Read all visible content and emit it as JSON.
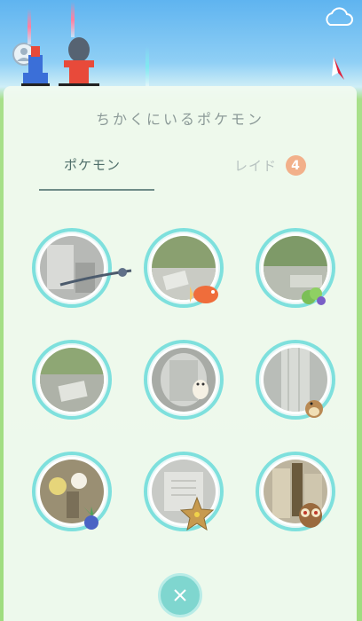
{
  "panel": {
    "title": "ちかくにいるポケモン"
  },
  "tabs": {
    "pokemon_label": "ポケモン",
    "raid_label": "レイド",
    "raid_count": "4"
  },
  "nearby_pokemon": [
    {
      "name": "",
      "icon": "weavile-icon"
    },
    {
      "name": "",
      "icon": "magikarp-icon"
    },
    {
      "name": "",
      "icon": "caterpie-icon"
    },
    {
      "name": "",
      "icon": "empty-slot"
    },
    {
      "name": "",
      "icon": "togepi-icon"
    },
    {
      "name": "",
      "icon": "pidgey-icon"
    },
    {
      "name": "",
      "icon": "oddish-icon"
    },
    {
      "name": "",
      "icon": "staryu-icon"
    },
    {
      "name": "",
      "icon": "hoothoot-icon"
    }
  ],
  "colors": {
    "ring": "#7ee0dd",
    "raid_badge": "#f2b08a",
    "close_button": "#7fd6cf"
  }
}
